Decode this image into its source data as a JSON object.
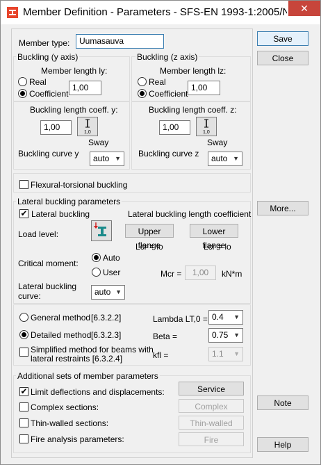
{
  "window": {
    "title": "Member Definition - Parameters - SFS-EN 1993-1:2005/N...",
    "close_glyph": "✕"
  },
  "member": {
    "type_label": "Member type:",
    "type_value": "Uumasauva"
  },
  "buckling_y": {
    "title": "Buckling (y axis)",
    "length_label": "Member length ly:",
    "real": "Real",
    "coefficient": "Coefficient",
    "length_value": "1,00",
    "coeff_label": "Buckling length coeff. y:",
    "coeff_value": "1,00",
    "sway_icon_text": "1,0",
    "sway": "Sway",
    "curve_label": "Buckling curve y",
    "curve_value": "auto"
  },
  "buckling_z": {
    "title": "Buckling (z axis)",
    "length_label": "Member length lz:",
    "real": "Real",
    "coefficient": "Coefficient",
    "length_value": "1,00",
    "coeff_label": "Buckling length coeff. z:",
    "coeff_value": "1,00",
    "sway_icon_text": "1,0",
    "sway": "Sway",
    "curve_label": "Buckling curve z",
    "curve_value": "auto"
  },
  "flexural": {
    "label": "Flexural-torsional buckling"
  },
  "lateral": {
    "title": "Lateral buckling parameters",
    "checkbox": "Lateral buckling",
    "length_coeff_title": "Lateral buckling length coefficient",
    "load_level": "Load level:",
    "upper": "Upper flange",
    "lower": "Lower flange",
    "lcr_upper": "Lcr = lo",
    "lcr_lower": "Lcr = lo",
    "critical_moment": "Critical moment:",
    "auto": "Auto",
    "user": "User",
    "mcr_label": "Mcr =",
    "mcr_value": "1,00",
    "mcr_unit": "kN*m",
    "curve_label_1": "Lateral buckling",
    "curve_label_2": "curve:",
    "curve_value": "auto"
  },
  "method": {
    "general": "General method",
    "general_ref": "[6.3.2.2]",
    "detailed": "Detailed method",
    "detailed_ref": "[6.3.2.3]",
    "simplified_1": "Simplified method for beams with",
    "simplified_2": "lateral restraints [6.3.2.4]",
    "lambda_label": "Lambda LT,0 =",
    "lambda_value": "0.4",
    "beta_label": "Beta =",
    "beta_value": "0.75",
    "kfl_label": "kfl =",
    "kfl_value": "1.1"
  },
  "additional": {
    "title": "Additional sets of member parameters",
    "limit": "Limit deflections and displacements:",
    "service": "Service",
    "complex_label": "Complex sections:",
    "complex_btn": "Complex",
    "thin_label": "Thin-walled sections:",
    "thin_btn": "Thin-walled",
    "fire_label": "Fire analysis parameters:",
    "fire_btn": "Fire"
  },
  "side": {
    "save": "Save",
    "close": "Close",
    "more": "More...",
    "note": "Note",
    "help": "Help"
  }
}
